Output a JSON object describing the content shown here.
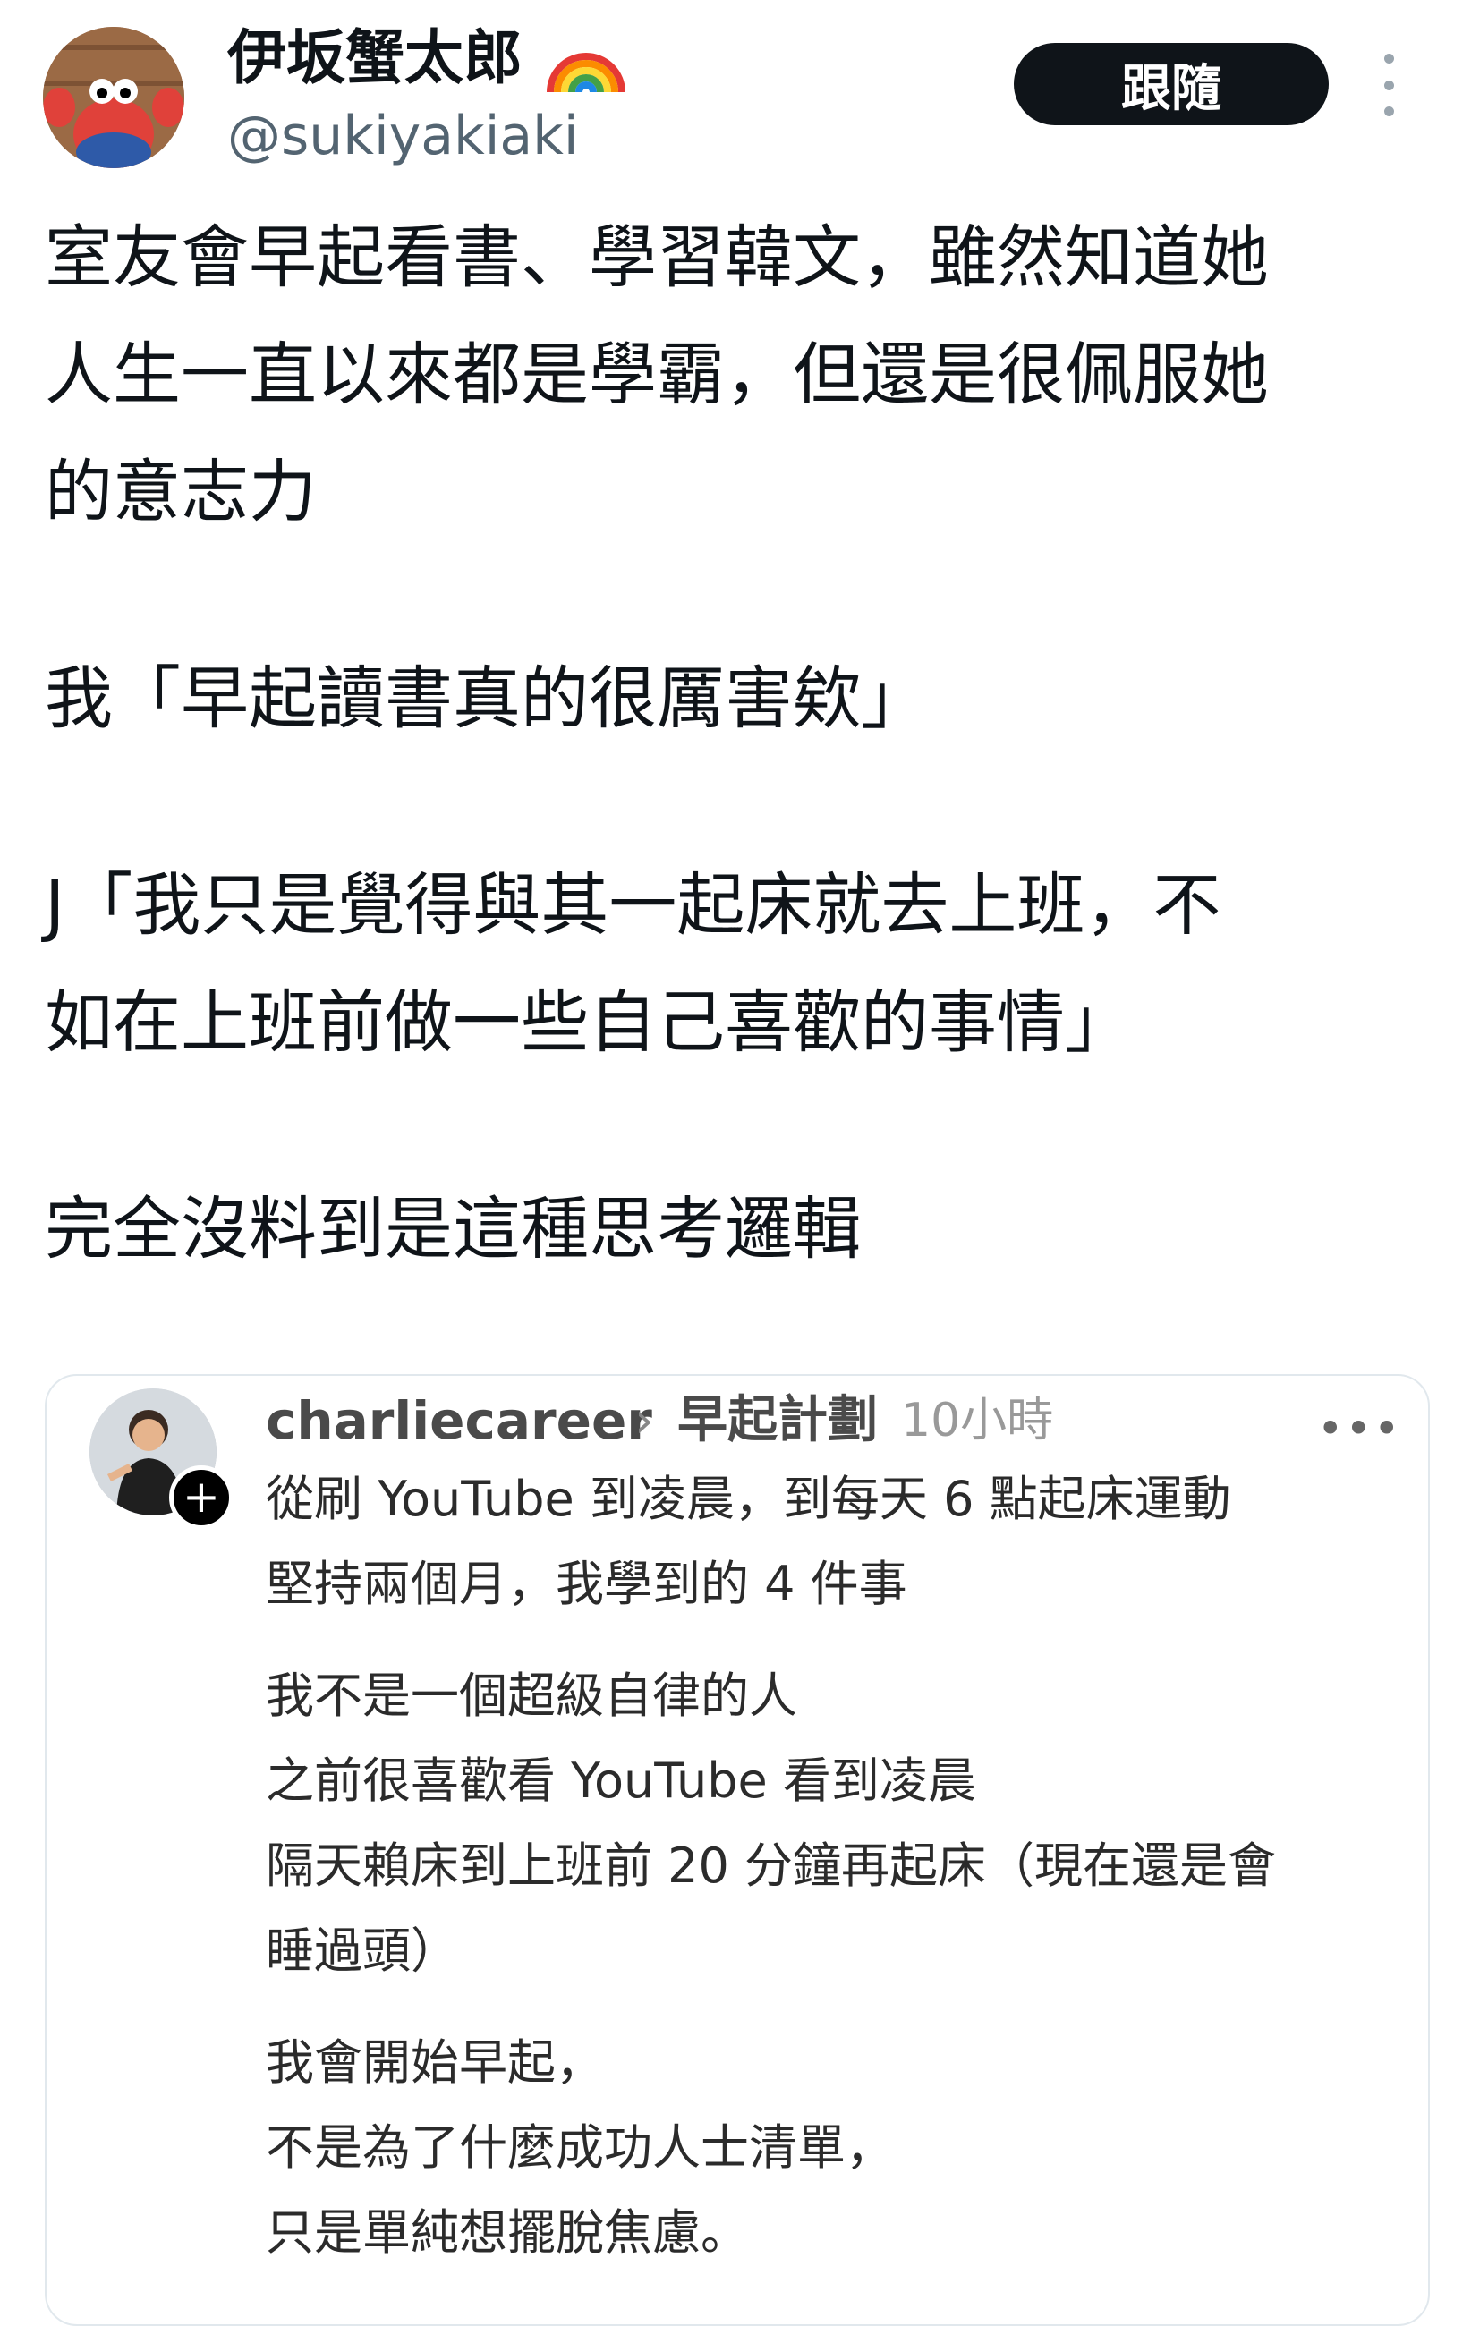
{
  "post": {
    "display_name": "伊坂蟹太郎",
    "handle": "@sukiyakiaki",
    "follow_label": "跟隨",
    "body_paragraphs": [
      "室友會早起看書、學習韓文，雖然知道她\n人生一直以來都是學霸，但還是很佩服她\n的意志力",
      "我「早起讀書真的很厲害欸」",
      "J「我只是覺得與其一起床就去上班，不\n如在上班前做一些自己喜歡的事情」",
      "完全沒料到是這種思考邏輯"
    ]
  },
  "quote": {
    "username": "charliecareer",
    "arrow": "›",
    "topic": "早起計劃",
    "time": "10小時",
    "more": "•••",
    "plus": "+",
    "paragraphs": [
      "從刷 YouTube 到凌晨，到每天 6 點起床運動\n堅持兩個月，我學到的 4 件事",
      "我不是一個超級自律的人\n之前很喜歡看 YouTube 看到凌晨\n隔天賴床到上班前 20 分鐘再起床（現在還是會\n睡過頭）",
      "我會開始早起，\n不是為了什麼成功人士清單，\n只是單純想擺脫焦慮。"
    ]
  },
  "icons": {
    "rainbow": "rainbow-emoji",
    "more": "more-dots-icon"
  },
  "colors": {
    "follow_bg": "#0f1419",
    "handle": "#536471",
    "card_border": "#e1e8ed"
  }
}
